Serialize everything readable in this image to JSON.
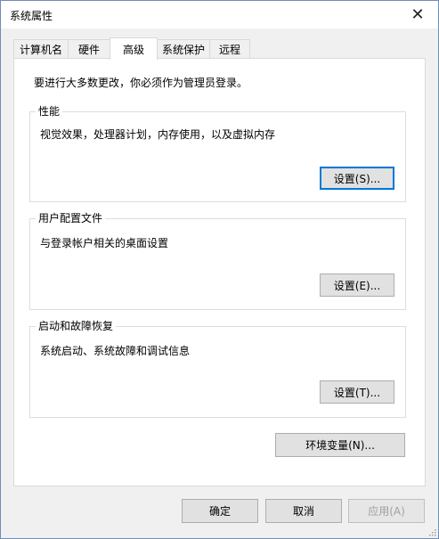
{
  "window": {
    "title": "系统属性",
    "close_glyph": "✕"
  },
  "tabs": [
    {
      "label": "计算机名",
      "active": false
    },
    {
      "label": "硬件",
      "active": false
    },
    {
      "label": "高级",
      "active": true
    },
    {
      "label": "系统保护",
      "active": false
    },
    {
      "label": "远程",
      "active": false
    }
  ],
  "advanced": {
    "intro": "要进行大多数更改，你必须作为管理员登录。",
    "performance": {
      "title": "性能",
      "description": "视觉效果，处理器计划，内存使用，以及虚拟内存",
      "button": "设置(S)..."
    },
    "user_profiles": {
      "title": "用户配置文件",
      "description": "与登录帐户相关的桌面设置",
      "button": "设置(E)..."
    },
    "startup_recovery": {
      "title": "启动和故障恢复",
      "description": "系统启动、系统故障和调试信息",
      "button": "设置(T)..."
    },
    "env_button": "环境变量(N)..."
  },
  "footer": {
    "ok": "确定",
    "cancel": "取消",
    "apply": "应用(A)"
  },
  "colors": {
    "focus_border": "#0078d7",
    "window_bg": "#f0f0f0",
    "panel_bg": "#ffffff"
  }
}
